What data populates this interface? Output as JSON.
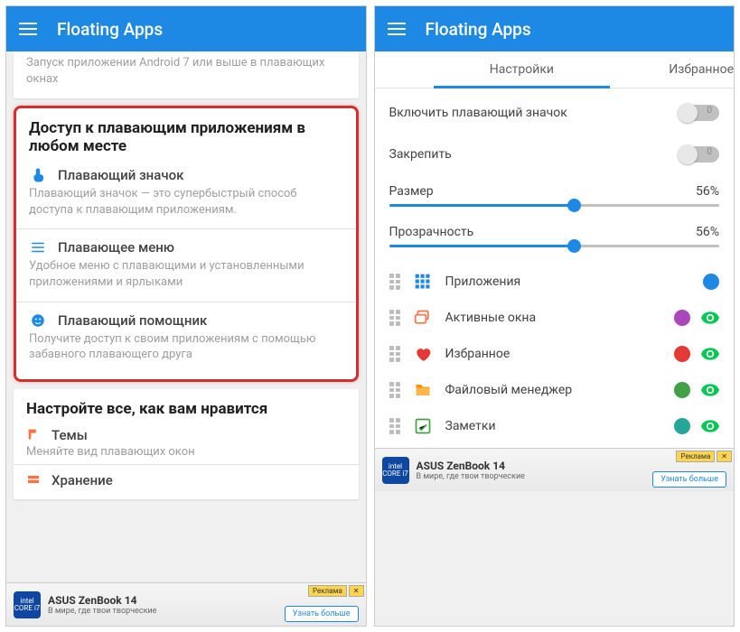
{
  "appbar": {
    "title": "Floating Apps"
  },
  "left": {
    "partial_top": "Запуск приложении Android 7 или выше в плавающих окнах",
    "access_section": {
      "title": "Доступ к плавающим приложениям в любом месте",
      "items": [
        {
          "title": "Плавающий значок",
          "sub": "Плавающий значок — это супербыстрый способ доступа к плавающим приложениям."
        },
        {
          "title": "Плавающее меню",
          "sub": "Удобное меню с плавающими и установленными приложениями и ярлыками"
        },
        {
          "title": "Плавающий помощник",
          "sub": "Получите доступ к своим приложениям с помощью забавного плавающего друга"
        }
      ]
    },
    "customize_section": {
      "title": "Настройте все, как вам нравится",
      "items": [
        {
          "title": "Темы",
          "sub": "Меняйте вид плавающих окон"
        },
        {
          "title": "Хранение",
          "sub": ""
        }
      ]
    }
  },
  "right": {
    "tabs": {
      "active": "Настройки",
      "other": "Избранное"
    },
    "switches": [
      {
        "label": "Включить плавающий значок",
        "on": false,
        "zero_text": "0"
      },
      {
        "label": "Закрепить",
        "on": false,
        "zero_text": "0"
      }
    ],
    "sliders": [
      {
        "label": "Размер",
        "value_label": "56%",
        "value": 56
      },
      {
        "label": "Прозрачность",
        "value_label": "56%",
        "value": 56
      }
    ],
    "rows": [
      {
        "label": "Приложения",
        "icon": "grid",
        "icon_color": "#1e88e5",
        "dot_color": "#1e88e5",
        "eye": false
      },
      {
        "label": "Активные окна",
        "icon": "windows",
        "icon_color": "#ff7043",
        "dot_color": "#ab47bc",
        "eye": true
      },
      {
        "label": "Избранное",
        "icon": "heart",
        "icon_color": "#e53935",
        "dot_color": "#e53935",
        "eye": true
      },
      {
        "label": "Файловый менеджер",
        "icon": "folder",
        "icon_color": "#fb8c00",
        "dot_color": "#43a047",
        "eye": true
      },
      {
        "label": "Заметки",
        "icon": "note",
        "icon_color": "#43a047",
        "dot_color": "#26a69a",
        "eye": true
      }
    ]
  },
  "ad": {
    "chip": "intel CORE i7",
    "title": "ASUS ZenBook 14",
    "sub": "В мире, где твои творческие",
    "badge1": "Реклама",
    "badge2": "✕",
    "btn": "Узнать больше"
  }
}
